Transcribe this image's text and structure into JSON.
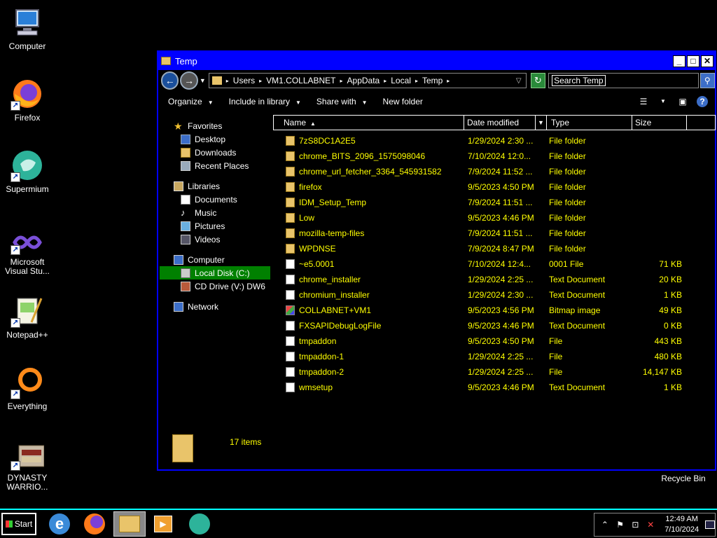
{
  "desktop": {
    "icons": [
      {
        "label": "Computer",
        "icon": "computer-icon"
      },
      {
        "label": "Firefox",
        "icon": "firefox-icon"
      },
      {
        "label": "Supermium",
        "icon": "supermium-icon"
      },
      {
        "label": "Microsoft Visual Stu...",
        "icon": "visual-studio-icon"
      },
      {
        "label": "Notepad++",
        "icon": "notepadpp-icon"
      },
      {
        "label": "Everything",
        "icon": "everything-icon"
      },
      {
        "label": "DYNASTY WARRIO...",
        "icon": "dynasty-warriors-icon"
      }
    ],
    "recycle_bin": "Recycle Bin"
  },
  "window": {
    "title": "Temp",
    "address": {
      "crumbs": [
        "Users",
        "VM1.COLLABNET",
        "AppData",
        "Local",
        "Temp"
      ]
    },
    "search_placeholder": "Search Temp",
    "toolbar": {
      "organize": "Organize",
      "include_in_library": "Include in library",
      "share_with": "Share with",
      "new_folder": "New folder"
    },
    "nav": {
      "favorites": "Favorites",
      "desktop": "Desktop",
      "downloads": "Downloads",
      "recent_places": "Recent Places",
      "libraries": "Libraries",
      "documents": "Documents",
      "music": "Music",
      "pictures": "Pictures",
      "videos": "Videos",
      "computer": "Computer",
      "local_disk": "Local Disk (C:)",
      "cd_drive": "CD Drive (V:) DW6",
      "network": "Network"
    },
    "columns": {
      "name": "Name",
      "date_modified": "Date modified",
      "type": "Type",
      "size": "Size"
    },
    "files": [
      {
        "name": "7zS8DC1A2E5",
        "date": "1/29/2024 2:30 ...",
        "type": "File folder",
        "size": "",
        "kind": "folder"
      },
      {
        "name": "chrome_BITS_2096_1575098046",
        "date": "7/10/2024 12:0...",
        "type": "File folder",
        "size": "",
        "kind": "folder"
      },
      {
        "name": "chrome_url_fetcher_3364_545931582",
        "date": "7/9/2024 11:52 ...",
        "type": "File folder",
        "size": "",
        "kind": "folder"
      },
      {
        "name": "firefox",
        "date": "9/5/2023 4:50 PM",
        "type": "File folder",
        "size": "",
        "kind": "folder"
      },
      {
        "name": "IDM_Setup_Temp",
        "date": "7/9/2024 11:51 ...",
        "type": "File folder",
        "size": "",
        "kind": "folder"
      },
      {
        "name": "Low",
        "date": "9/5/2023 4:46 PM",
        "type": "File folder",
        "size": "",
        "kind": "folder"
      },
      {
        "name": "mozilla-temp-files",
        "date": "7/9/2024 11:51 ...",
        "type": "File folder",
        "size": "",
        "kind": "folder"
      },
      {
        "name": "WPDNSE",
        "date": "7/9/2024 8:47 PM",
        "type": "File folder",
        "size": "",
        "kind": "folder"
      },
      {
        "name": "~e5.0001",
        "date": "7/10/2024 12:4...",
        "type": "0001 File",
        "size": "71 KB",
        "kind": "doc"
      },
      {
        "name": "chrome_installer",
        "date": "1/29/2024 2:25 ...",
        "type": "Text Document",
        "size": "20 KB",
        "kind": "doc"
      },
      {
        "name": "chromium_installer",
        "date": "1/29/2024 2:30 ...",
        "type": "Text Document",
        "size": "1 KB",
        "kind": "doc"
      },
      {
        "name": "COLLABNET+VM1",
        "date": "9/5/2023 4:56 PM",
        "type": "Bitmap image",
        "size": "49 KB",
        "kind": "bmp"
      },
      {
        "name": "FXSAPIDebugLogFile",
        "date": "9/5/2023 4:46 PM",
        "type": "Text Document",
        "size": "0 KB",
        "kind": "doc"
      },
      {
        "name": "tmpaddon",
        "date": "9/5/2023 4:50 PM",
        "type": "File",
        "size": "443 KB",
        "kind": "doc"
      },
      {
        "name": "tmpaddon-1",
        "date": "1/29/2024 2:25 ...",
        "type": "File",
        "size": "480 KB",
        "kind": "doc"
      },
      {
        "name": "tmpaddon-2",
        "date": "1/29/2024 2:25 ...",
        "type": "File",
        "size": "14,147 KB",
        "kind": "doc"
      },
      {
        "name": "wmsetup",
        "date": "9/5/2023 4:46 PM",
        "type": "Text Document",
        "size": "1 KB",
        "kind": "doc"
      }
    ],
    "status": "17 items"
  },
  "taskbar": {
    "start": "Start",
    "time": "12:49 AM",
    "date": "7/10/2024"
  },
  "colors": {
    "accent": "#0000ff",
    "file_text": "#ffff00",
    "selection": "#008000",
    "taskbar_border": "#00ffff"
  }
}
